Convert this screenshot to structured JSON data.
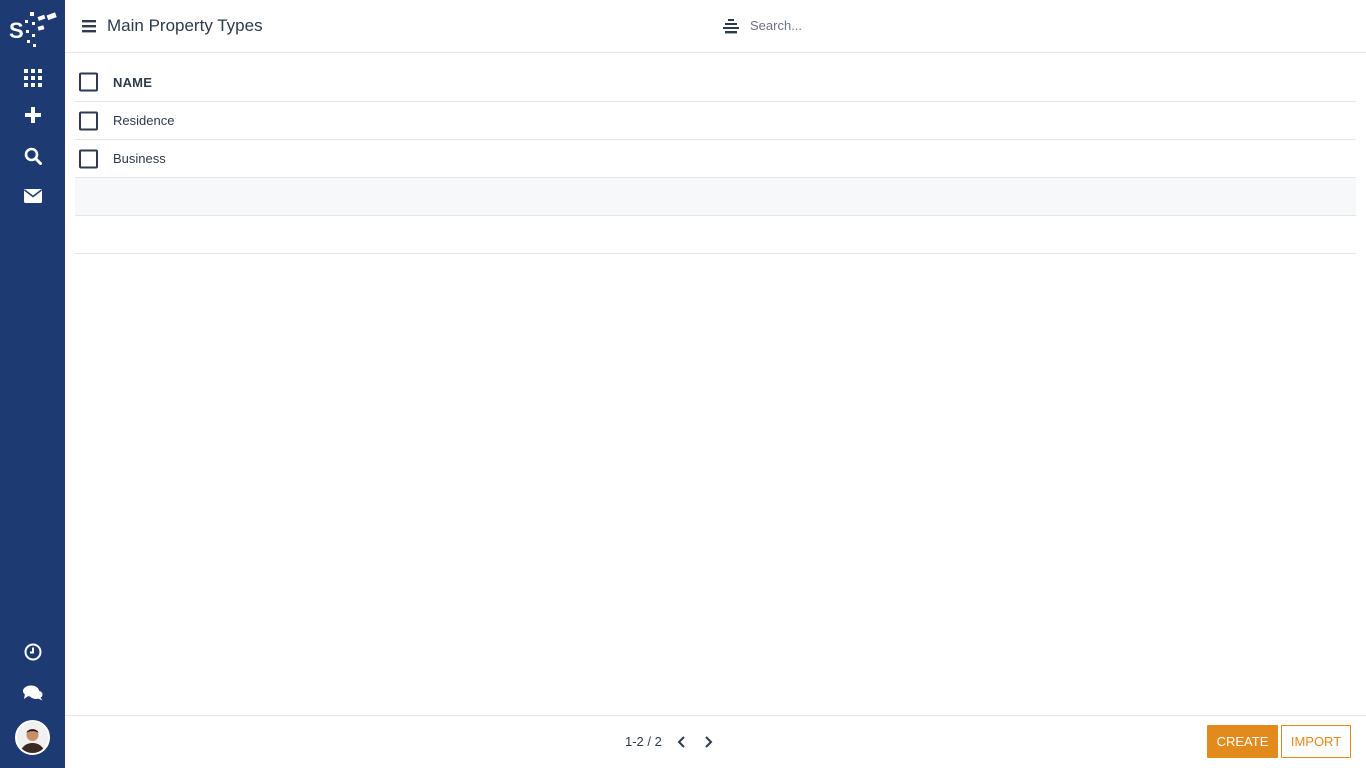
{
  "header": {
    "title": "Main Property Types",
    "search_placeholder": "Search..."
  },
  "sidebar": {
    "logo_letter": "S",
    "icons": [
      "apps-grid-icon",
      "plus-icon",
      "search-icon",
      "envelope-icon",
      "clock-icon",
      "chat-icon",
      "avatar"
    ]
  },
  "table": {
    "column_header": "NAME",
    "rows": [
      "Residence",
      "Business"
    ]
  },
  "footer": {
    "pager": "1-2 / 2",
    "create_label": "CREATE",
    "import_label": "IMPORT"
  },
  "colors": {
    "sidebar": "#1e3a72",
    "accent": "#e38a1d",
    "text": "#2e3a4d"
  }
}
